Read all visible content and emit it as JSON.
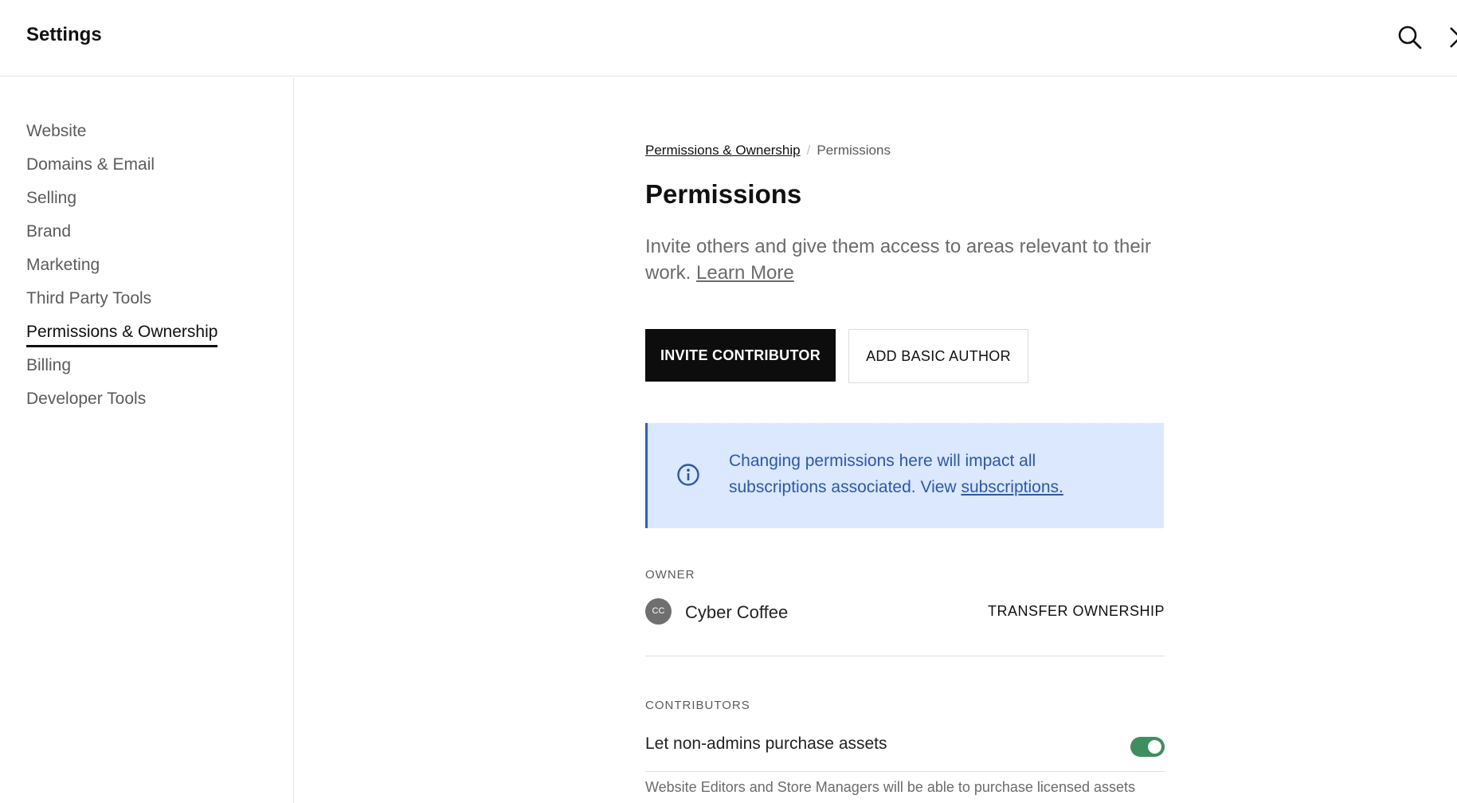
{
  "header": {
    "title": "Settings",
    "search_icon": "search-icon",
    "close_icon": "close-icon"
  },
  "sidebar": {
    "items": [
      {
        "label": "Website"
      },
      {
        "label": "Domains & Email"
      },
      {
        "label": "Selling"
      },
      {
        "label": "Brand"
      },
      {
        "label": "Marketing"
      },
      {
        "label": "Third Party Tools"
      },
      {
        "label": "Permissions & Ownership",
        "active": true
      },
      {
        "label": "Billing"
      },
      {
        "label": "Developer Tools"
      }
    ]
  },
  "breadcrumb": {
    "parent": "Permissions & Ownership",
    "separator": "/",
    "current": "Permissions"
  },
  "main": {
    "title": "Permissions",
    "description": "Invite others and give them access to areas relevant to their work.",
    "learn_more": "Learn More",
    "invite_button": "INVITE CONTRIBUTOR",
    "add_author_button": "ADD BASIC AUTHOR"
  },
  "notice": {
    "text": "Changing permissions here will impact all subscriptions associated. View",
    "link": "subscriptions.",
    "icon": "info-icon",
    "accent": "#2a5fd3",
    "background": "#dbe8fd"
  },
  "owner": {
    "label": "OWNER",
    "initials": "CC",
    "name": "Cyber Coffee",
    "transfer": "TRANSFER OWNERSHIP"
  },
  "contributors": {
    "label": "CONTRIBUTORS",
    "toggle_label": "Let non-admins purchase assets",
    "toggle_on": true,
    "toggle_color": "#3e8f5e",
    "help": "Website Editors and Store Managers will be able to purchase licensed assets"
  }
}
